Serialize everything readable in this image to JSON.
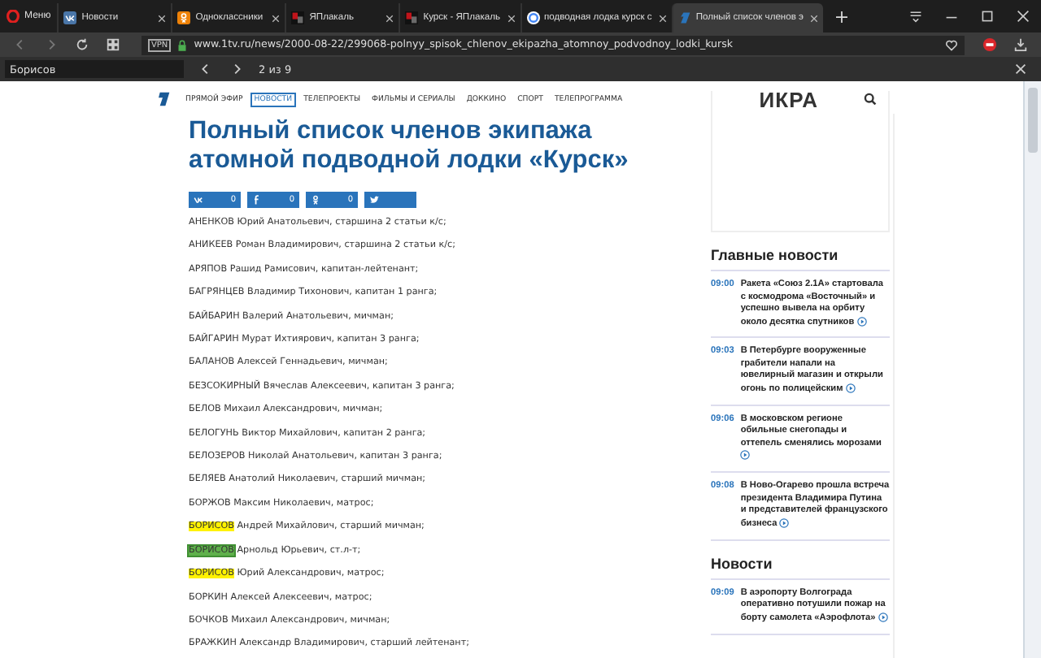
{
  "browser": {
    "menu_label": "Меню",
    "tabs": [
      {
        "title": "Новости",
        "selected": false
      },
      {
        "title": "Одноклассники",
        "selected": false
      },
      {
        "title": "ЯПлакаль",
        "selected": false
      },
      {
        "title": "Курск - ЯПлакаль",
        "selected": false
      },
      {
        "title": "подводная лодка курск с",
        "selected": false
      },
      {
        "title": "Полный список членов э",
        "selected": true
      }
    ],
    "vpn_label": "VPN",
    "url": "www.1tv.ru/news/2000-08-22/299068-polnyy_spisok_chlenov_ekipazha_atomnoy_podvodnoy_lodki_kursk",
    "find": {
      "value": "Борисов",
      "count": "2 из 9"
    }
  },
  "site": {
    "nav": [
      {
        "label": "ПРЯМОЙ ЭФИР",
        "selected": false
      },
      {
        "label": "НОВОСТИ",
        "selected": true
      },
      {
        "label": "ТЕЛЕПРОЕКТЫ",
        "selected": false
      },
      {
        "label": "ФИЛЬМЫ И СЕРИАЛЫ",
        "selected": false
      },
      {
        "label": "ДОККИНО",
        "selected": false
      },
      {
        "label": "СПОРТ",
        "selected": false
      },
      {
        "label": "ТЕЛЕПРОГРАММА",
        "selected": false
      }
    ],
    "promo": "ИКРА",
    "title": "Полный список членов экипажа атомной подводной лодки «Курск»",
    "share": [
      {
        "kind": "vk",
        "count": "0"
      },
      {
        "kind": "facebook",
        "count": "0"
      },
      {
        "kind": "ok",
        "count": "0"
      },
      {
        "kind": "twitter"
      }
    ],
    "crew": [
      {
        "surname": "АНЕНКОВ",
        "rest": "Юрий Анатольевич, старшина 2 статьи к/с;",
        "highlighted": false,
        "selected": false
      },
      {
        "surname": "АНИКЕЕВ",
        "rest": "Роман Владимирович, старшина 2 статьи к/с;",
        "highlighted": false,
        "selected": false
      },
      {
        "surname": "АРЯПОВ",
        "rest": "Рашид Рамисович, капитан-лейтенант;",
        "highlighted": false,
        "selected": false
      },
      {
        "surname": "БАГРЯНЦЕВ",
        "rest": "Владимир Тихонович, капитан 1 ранга;",
        "highlighted": false,
        "selected": false
      },
      {
        "surname": "БАЙБАРИН",
        "rest": "Валерий Анатольевич, мичман;",
        "highlighted": false,
        "selected": false
      },
      {
        "surname": "БАЙГАРИН",
        "rest": "Мурат Ихтиярович, капитан 3 ранга;",
        "highlighted": false,
        "selected": false
      },
      {
        "surname": "БАЛАНОВ",
        "rest": "Алексей Геннадьевич, мичман;",
        "highlighted": false,
        "selected": false
      },
      {
        "surname": "БЕЗСОКИРНЫЙ",
        "rest": "Вячеслав Алексеевич, капитан 3 ранга;",
        "highlighted": false,
        "selected": false
      },
      {
        "surname": "БЕЛОВ",
        "rest": "Михаил Александрович, мичман;",
        "highlighted": false,
        "selected": false
      },
      {
        "surname": "БЕЛОГУНЬ",
        "rest": "Виктор Михайлович, капитан 2 ранга;",
        "highlighted": false,
        "selected": false
      },
      {
        "surname": "БЕЛОЗЕРОВ",
        "rest": "Николай Анатольевич, капитан 3 ранга;",
        "highlighted": false,
        "selected": false
      },
      {
        "surname": "БЕЛЯЕВ",
        "rest": "Анатолий Николаевич, старший мичман;",
        "highlighted": false,
        "selected": false
      },
      {
        "surname": "БОРЖОВ",
        "rest": "Максим Николаевич, матрос;",
        "highlighted": false,
        "selected": false
      },
      {
        "surname": "БОРИСОВ",
        "rest": "Андрей Михайлович, старший мичман;",
        "highlighted": true,
        "selected": false
      },
      {
        "surname": "БОРИСОВ",
        "rest": "Арнольд Юрьевич, ст.л-т;",
        "highlighted": true,
        "selected": true
      },
      {
        "surname": "БОРИСОВ",
        "rest": "Юрий Александрович, матрос;",
        "highlighted": true,
        "selected": false
      },
      {
        "surname": "БОРКИН",
        "rest": "Алексей Алексеевич, матрос;",
        "highlighted": false,
        "selected": false
      },
      {
        "surname": "БОЧКОВ",
        "rest": "Михаил Александрович, мичман;",
        "highlighted": false,
        "selected": false
      },
      {
        "surname": "БРАЖКИН",
        "rest": "Александр Владимирович, старший лейтенант;",
        "highlighted": false,
        "selected": false
      }
    ],
    "sidebar": [
      {
        "heading": "Главные новости",
        "items": [
          {
            "time": "09:00",
            "text": "Ракета «Союз 2.1А» стартовала с космодрома «Восточный» и успешно вывела на орбиту около десятка спутников"
          },
          {
            "time": "09:03",
            "text": "В Петербурге вооруженные грабители напали на ювелирный магазин и открыли огонь по полицейским"
          },
          {
            "time": "09:06",
            "text": "В московском регионе обильные снегопады и оттепель сменялись морозами"
          },
          {
            "time": "09:08",
            "text": "В Ново-Огарево прошла встреча президента Владимира Путина и представителей французского бизнеса"
          }
        ]
      },
      {
        "heading": "Новости",
        "items": [
          {
            "time": "09:09",
            "text": "В аэропорту Волгограда оперативно потушили пожар на борту самолета «Аэрофлота»"
          }
        ]
      }
    ]
  }
}
